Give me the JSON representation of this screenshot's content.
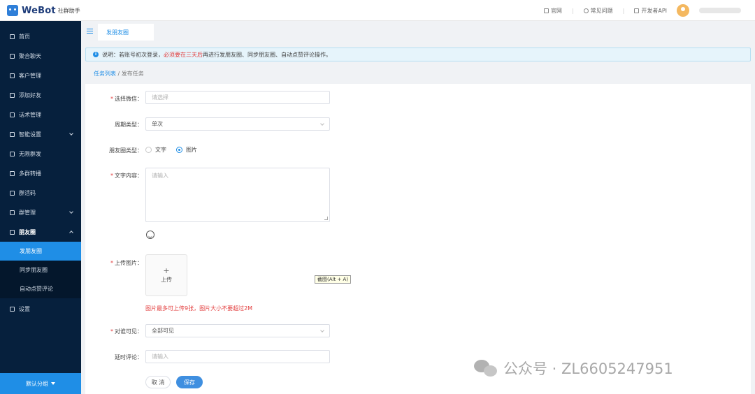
{
  "app": {
    "brand": "WeBot",
    "brand_sub": "社群助手"
  },
  "header": {
    "links": [
      {
        "label": "官网",
        "icon": "monitor-icon"
      },
      {
        "label": "常见问题",
        "icon": "question-icon"
      },
      {
        "label": "开发者API",
        "icon": "doc-icon"
      }
    ]
  },
  "sidebar": {
    "items": [
      {
        "label": "首页",
        "icon": "home-icon"
      },
      {
        "label": "聚合聊天",
        "icon": "chat-icon"
      },
      {
        "label": "客户管理",
        "icon": "user-icon"
      },
      {
        "label": "添加好友",
        "icon": "add-user-icon"
      },
      {
        "label": "话术管理",
        "icon": "script-icon"
      },
      {
        "label": "智能设置",
        "icon": "smart-icon"
      },
      {
        "label": "无限群发",
        "icon": "send-icon"
      },
      {
        "label": "多群转播",
        "icon": "broadcast-icon"
      },
      {
        "label": "群活码",
        "icon": "qrcode-icon"
      },
      {
        "label": "群管理",
        "icon": "group-icon"
      },
      {
        "label": "朋友圈",
        "icon": "moments-icon"
      },
      {
        "label": "设置",
        "icon": "gear-icon"
      }
    ],
    "sub_items": [
      {
        "label": "发朋友圈"
      },
      {
        "label": "同步朋友圈"
      },
      {
        "label": "自动点赞评论"
      }
    ],
    "footer": "默认分组"
  },
  "tabs": {
    "active": "发朋友圈"
  },
  "notice": {
    "prefix": "说明：若账号初次登录，",
    "highlight": "必须要在三天后",
    "suffix": "再进行发朋友圈、同步朋友圈、自动点赞评论操作。"
  },
  "breadcrumb": {
    "parent": "任务列表",
    "separator": "/",
    "current": "发布任务"
  },
  "form": {
    "wechat": {
      "label": "选择微信",
      "placeholder": "请选择"
    },
    "period": {
      "label": "周期类型",
      "value": "单次"
    },
    "moment_type": {
      "label": "朋友圈类型",
      "options": [
        "文字",
        "图片"
      ],
      "selected": "图片"
    },
    "content": {
      "label": "文字内容",
      "placeholder": "请输入"
    },
    "upload": {
      "label": "上传图片",
      "button": "上传",
      "hint": "图片最多可上传9张，图片大小不要超过2M",
      "tooltip": "截图(Alt + A)"
    },
    "visible": {
      "label": "对谁可见",
      "value": "全部可见"
    },
    "delay_comment": {
      "label": "延时评论",
      "placeholder": "请输入"
    },
    "cancel": "取 消",
    "save": "保存"
  },
  "watermark": {
    "text": "公众号 · ZL6605247951"
  }
}
